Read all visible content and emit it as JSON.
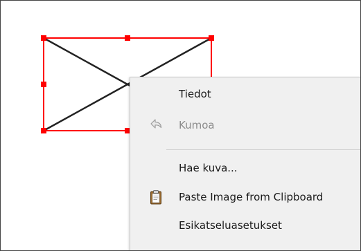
{
  "menu": {
    "items": [
      {
        "label": "Tiedot",
        "enabled": true,
        "icon": ""
      },
      {
        "label": "Kumoa",
        "enabled": false,
        "icon": "undo-icon"
      },
      {
        "label": "Hae kuva...",
        "enabled": true,
        "icon": ""
      },
      {
        "label": "Paste Image from Clipboard",
        "enabled": true,
        "icon": "clipboard-icon"
      },
      {
        "label": "Esikatseluasetukset",
        "enabled": true,
        "icon": ""
      }
    ]
  },
  "colors": {
    "selection_handle": "#ff0000",
    "placeholder_stroke": "#222222",
    "menu_background": "#f0f0f0",
    "disabled_text": "#8c8c8c"
  }
}
